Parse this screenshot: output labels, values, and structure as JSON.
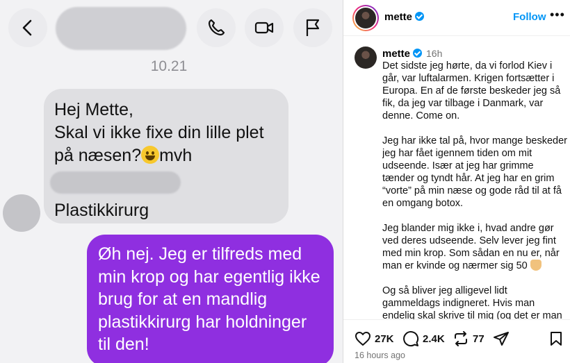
{
  "chat": {
    "time": "10.21",
    "incoming": {
      "line1": "Hej Mette,",
      "line2": "Skal vi ikke fixe din lille plet",
      "line3": "på næsen?",
      "line3_tail": "mvh",
      "line4": "Plastikkirurg"
    },
    "outgoing": {
      "text": "Øh nej. Jeg er tilfreds med min krop og har egentlig ikke brug for at en mandlig plastikkirurg har holdninger til den!"
    },
    "bubble_colors": {
      "incoming": "#dfdfe2",
      "outgoing": "#8f2fe0"
    },
    "icons": [
      "back-icon",
      "phone-icon",
      "video-icon",
      "flag-icon",
      "grinning-emoji-icon"
    ]
  },
  "instagram": {
    "username": "mette",
    "follow_label": "Follow",
    "more_label": "•••",
    "post_age_short": "16h",
    "caption": [
      "Det sidste jeg hørte, da vi forlod Kiev i går, var luftalarmen. Krigen fortsætter i Europa. En af de første beskeder jeg så fik, da jeg var tilbage i Danmark, var denne. Come on.",
      "Jeg har ikke tal på, hvor mange beskeder jeg har fået igennem tiden om mit udseende. Især at jeg har grimme tænder og tyndt hår. At jeg har en grim “vorte” på min næse og gode råd til at få en omgang botox.",
      "Jeg blander mig ikke i, hvad andre gør ved deres udseende. Selv lever jeg fint med min krop. Som sådan en nu er, når man er kvinde og nærmer sig 50",
      "Og så bliver jeg alligevel lidt gammeldags indigneret. Hvis man endelig skal skrive til mig (og det er man"
    ],
    "likes": "27K",
    "comments": "2.4K",
    "reposts": "77",
    "timestamp": "16 hours ago",
    "accent_color": "#0095f6",
    "icons": [
      "verified-badge-icon",
      "heart-icon",
      "comment-icon",
      "repost-icon",
      "share-icon",
      "bookmark-icon",
      "folded-hands-emoji-icon"
    ]
  }
}
